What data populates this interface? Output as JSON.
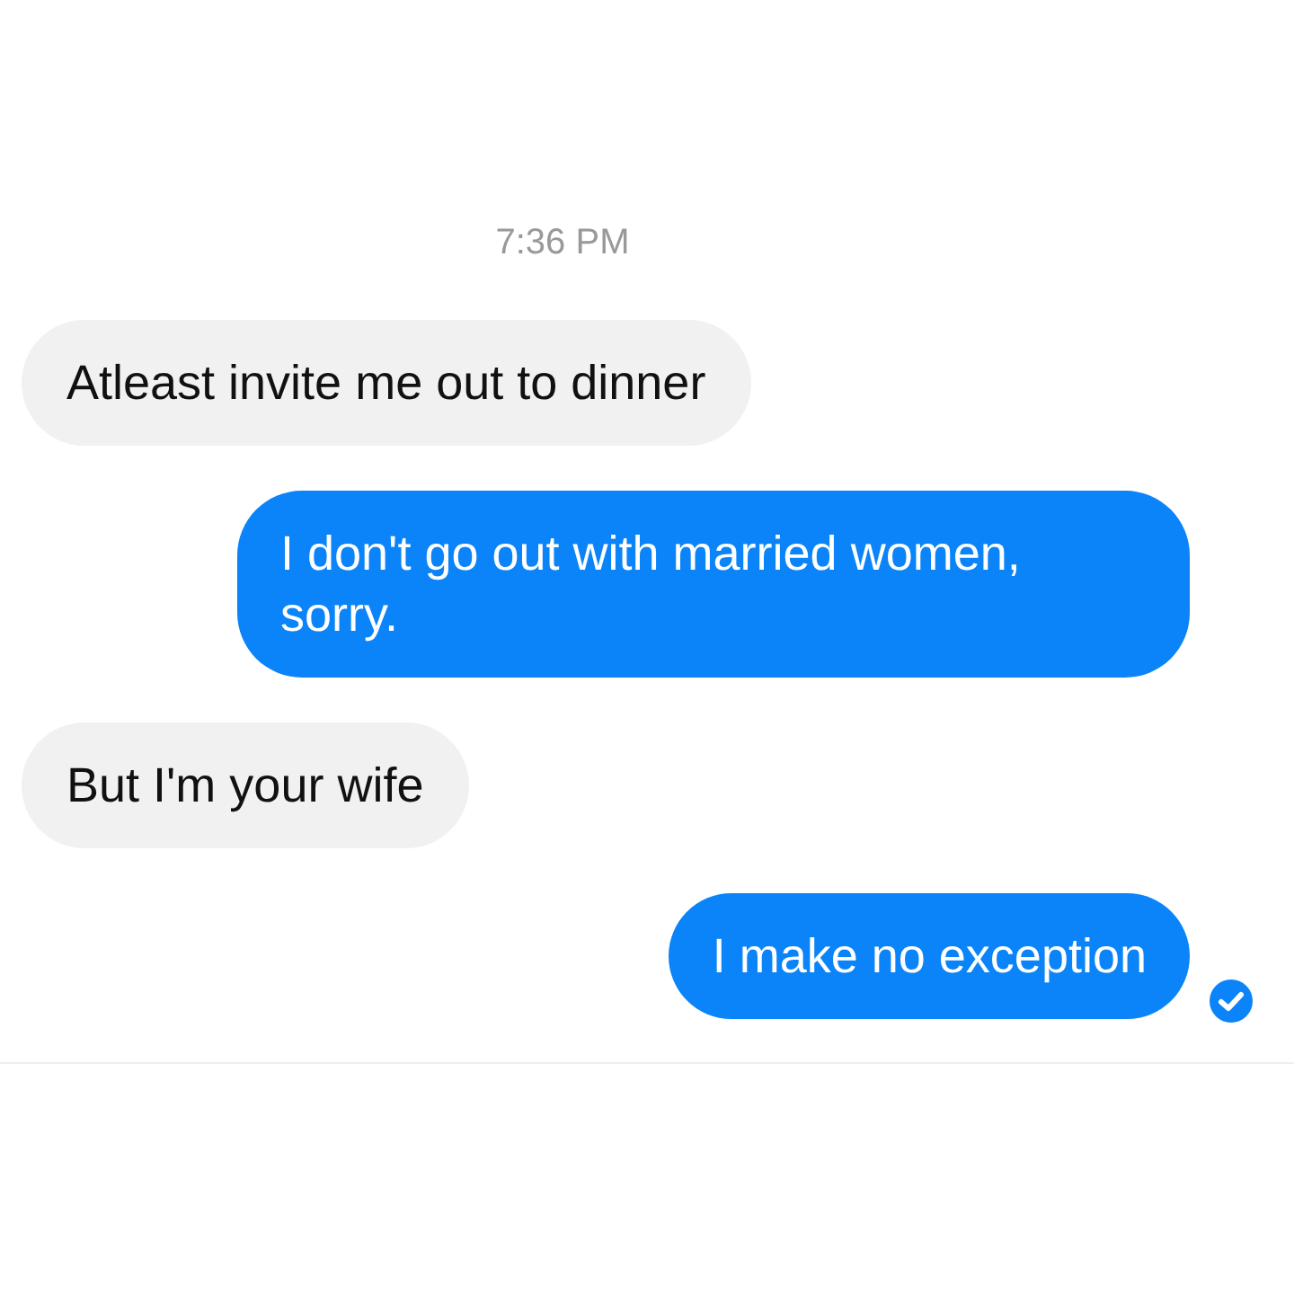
{
  "timestamp": "7:36 PM",
  "messages": [
    {
      "kind": "incoming",
      "text": "Atleast invite me out to dinner",
      "delivered": false
    },
    {
      "kind": "outgoing",
      "text": "I don't go out with married women, sorry.",
      "delivered": false
    },
    {
      "kind": "incoming",
      "text": "But I'm your wife",
      "delivered": false
    },
    {
      "kind": "outgoing",
      "text": "I make no exception",
      "delivered": true
    }
  ]
}
